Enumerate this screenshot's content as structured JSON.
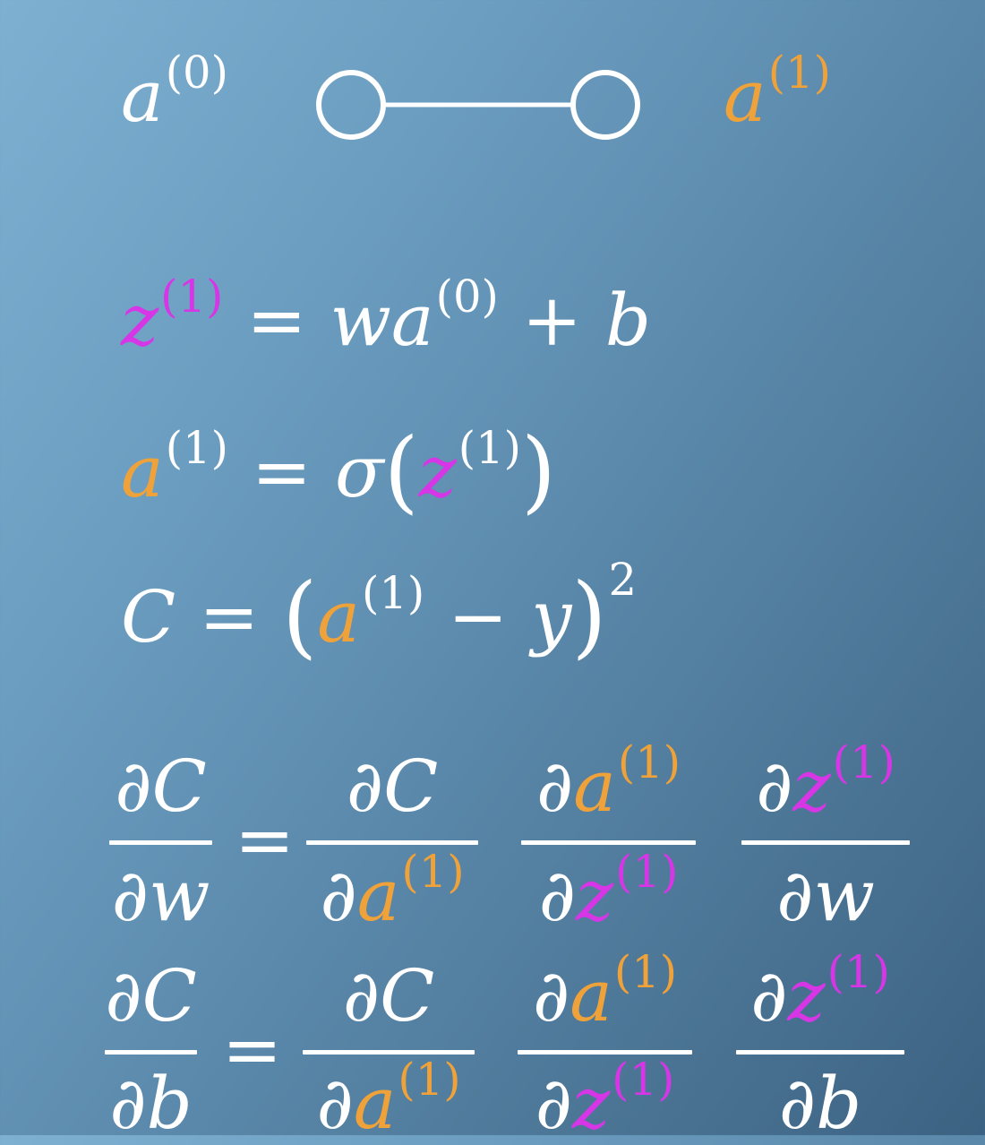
{
  "network": {
    "left_label": {
      "base": "a",
      "sup": "(0)"
    },
    "right_label": {
      "base": "a",
      "sup": "(1)"
    }
  },
  "eq1": {
    "lhs": "z",
    "lhs_sup": "(1)",
    "eq": "=",
    "w": "w",
    "a": "a",
    "a_sup": "(0)",
    "plus": "+",
    "b": "b"
  },
  "eq2": {
    "lhs": "a",
    "lhs_sup": "(1)",
    "eq": "=",
    "sigma": "σ",
    "open": "(",
    "z": "z",
    "z_sup": "(1)",
    "close": ")"
  },
  "eq3": {
    "lhs": "C",
    "eq": "=",
    "open": "(",
    "a": "a",
    "a_sup": "(1)",
    "minus": "−",
    "y": "y",
    "close": ")",
    "power": "2"
  },
  "eq4": {
    "lhs_num": "∂C",
    "lhs_den": "∂w",
    "eq": "=",
    "t1_num": "∂C",
    "t1_den_d": "∂",
    "t1_den_var": "a",
    "t1_den_sup": "(1)",
    "t2_num_d": "∂",
    "t2_num_var": "a",
    "t2_num_sup": "(1)",
    "t2_den_d": "∂",
    "t2_den_var": "z",
    "t2_den_sup": "(1)",
    "t3_num_d": "∂",
    "t3_num_var": "z",
    "t3_num_sup": "(1)",
    "t3_den": "∂w"
  },
  "eq5": {
    "lhs_num": "∂C",
    "lhs_den": "∂b",
    "eq": "=",
    "t1_num": "∂C",
    "t1_den_d": "∂",
    "t1_den_var": "a",
    "t1_den_sup": "(1)",
    "t2_num_d": "∂",
    "t2_num_var": "a",
    "t2_num_sup": "(1)",
    "t2_den_d": "∂",
    "t2_den_var": "z",
    "t2_den_sup": "(1)",
    "t3_num_d": "∂",
    "t3_num_var": "z",
    "t3_num_sup": "(1)",
    "t3_den": "∂b"
  },
  "colors": {
    "activation": "#f0a23a",
    "weighted_input": "#d636e6",
    "text": "#ffffff"
  }
}
